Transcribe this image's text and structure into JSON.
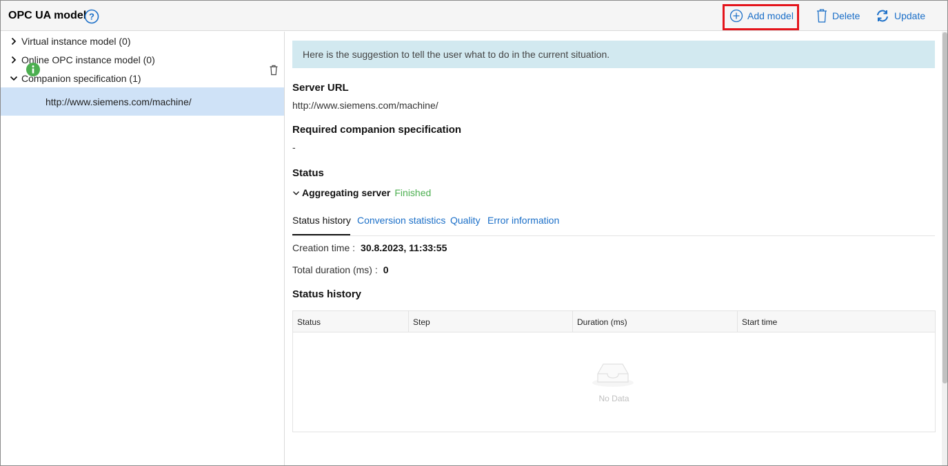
{
  "header": {
    "title": "OPC UA model",
    "help_icon": "help-circle-icon",
    "add_label": "Add model",
    "delete_label": "Delete",
    "update_label": "Update",
    "accent_color": "#1b6fc8",
    "highlight_color": "#e4141b"
  },
  "tree": {
    "items": [
      {
        "label": "Virtual instance model (0)",
        "expanded": false
      },
      {
        "label": "Online OPC instance model (0)",
        "expanded": false
      },
      {
        "label": "Companion specification (1)",
        "expanded": true
      }
    ],
    "selected_child": {
      "label": "http://www.siemens.com/machine/",
      "icon": "info-icon"
    }
  },
  "main": {
    "banner": "Here is the suggestion to tell the user what to do in the current situation.",
    "server_url_title": "Server URL",
    "server_url_value": "http://www.siemens.com/machine/",
    "required_spec_title": "Required companion specification",
    "required_spec_value": "-",
    "status_title": "Status",
    "status_server_label": "Aggregating server",
    "status_server_value": "Finished",
    "tabs": [
      {
        "label": "Status history",
        "active": true
      },
      {
        "label": "Conversion statistics",
        "active": false
      },
      {
        "label": "Quality",
        "active": false
      },
      {
        "label": "Error information",
        "active": false
      }
    ],
    "creation_label": "Creation time :",
    "creation_value": "30.8.2023, 11:33:55",
    "duration_label": "Total duration (ms) :",
    "duration_value": "0",
    "history_title": "Status history",
    "table": {
      "columns": [
        "Status",
        "Step",
        "Duration (ms)",
        "Start time"
      ],
      "empty_text": "No Data"
    }
  }
}
